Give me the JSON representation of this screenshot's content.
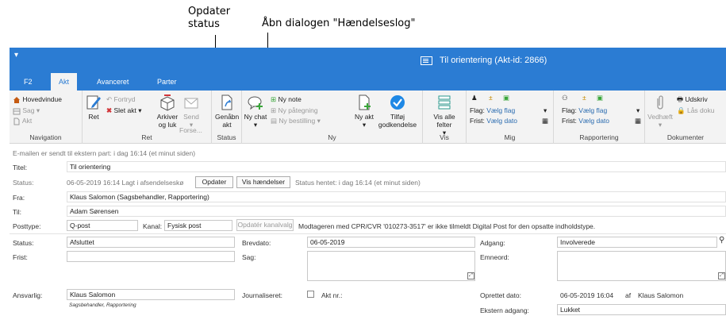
{
  "annotations": {
    "update_status": "Opdater status",
    "open_dialog": "Åbn dialogen \"Hændelseslog\""
  },
  "window": {
    "qat_symbol": "▾",
    "title": "Til orientering (Akt-id: 2866)"
  },
  "tabs": [
    "F2",
    "Akt",
    "Avanceret",
    "Parter"
  ],
  "ribbon": {
    "navigation": {
      "label": "Navigation",
      "main_window": "Hovedvindue",
      "case": "Sag",
      "doc": "Akt"
    },
    "ret": {
      "label": "Ret",
      "edit": "Ret",
      "undo": "Fortryd",
      "delete": "Slet akt",
      "archive": "Arkiver og luk",
      "send": "Send",
      "forward": "Forse..."
    },
    "status": {
      "label": "Status",
      "reopen": "Genåbn akt"
    },
    "ny": {
      "label": "Ny",
      "new_chat": "Ny chat",
      "new_note": "Ny note",
      "new_endorsement": "Ny påtegning",
      "new_order": "Ny bestilling",
      "new_doc": "Ny akt",
      "add_approval": "Tilføj godkendelse"
    },
    "vis": {
      "label": "Vis",
      "show_all": "Vis alle felter"
    },
    "mig": {
      "label": "Mig",
      "flag": "Flag:",
      "flag_value": "Vælg flag",
      "deadline": "Frist:",
      "deadline_value": "Vælg dato"
    },
    "rapportering": {
      "label": "Rapportering",
      "flag": "Flag:",
      "flag_value": "Vælg flag",
      "deadline": "Frist:",
      "deadline_value": "Vælg dato"
    },
    "dokumenter": {
      "label": "Dokumenter",
      "attach": "Vedhæft",
      "print": "Udskriv",
      "lock": "Lås doku"
    }
  },
  "form": {
    "sent_notice": "E-mailen er sendt til ekstern part:  i dag 16:14 (et minut siden)",
    "title_label": "Titel:",
    "title_value": "Til orientering",
    "status_label": "Status:",
    "status_text": "06-05-2019 16:14 Lagt i afsendelseskø",
    "update_button": "Opdater",
    "events_button": "Vis hændelser",
    "status_fetched": "Status hentet: i dag 16:14 (et minut siden)",
    "from_label": "Fra:",
    "from_value": "Klaus Salomon (Sagsbehandler, Rapportering)",
    "to_label": "Til:",
    "to_value": "Adam Sørensen",
    "posttype_label": "Posttype:",
    "posttype_value": "Q-post",
    "channel_label": "Kanal:",
    "channel_value": "Fysisk post",
    "update_channel_button": "Opdatér kanalvalg",
    "digital_post_notice": "Modtageren med CPR/CVR '010273-3517' er ikke tilmeldt Digital Post for den opsatte indholdstype.",
    "status2_label": "Status:",
    "status2_value": "Afsluttet",
    "letter_date_label": "Brevdato:",
    "letter_date_value": "06-05-2019",
    "access_label": "Adgang:",
    "access_value": "Involverede",
    "deadline_label": "Frist:",
    "deadline_value": "",
    "case_label": "Sag:",
    "case_value": "",
    "keywords_label": "Emneord:",
    "keywords_value": "",
    "responsible_label": "Ansvarlig:",
    "responsible_value": "Klaus Salomon",
    "responsible_sub": "Sagsbehandler, Rapportering",
    "journalized_label": "Journaliseret:",
    "doc_no_label": "Akt nr.:",
    "created_label": "Oprettet dato:",
    "created_value": "06-05-2019 16:04",
    "created_by_prefix": "af",
    "created_by": "Klaus Salomon",
    "ext_access_label": "Ekstern adgang:",
    "ext_access_value": "Lukket"
  },
  "colors": {
    "brand": "#2b7cd3",
    "ribbon_bg": "#f3f3f3",
    "delete_red": "#d13438",
    "check_green": "#1e88e5"
  }
}
